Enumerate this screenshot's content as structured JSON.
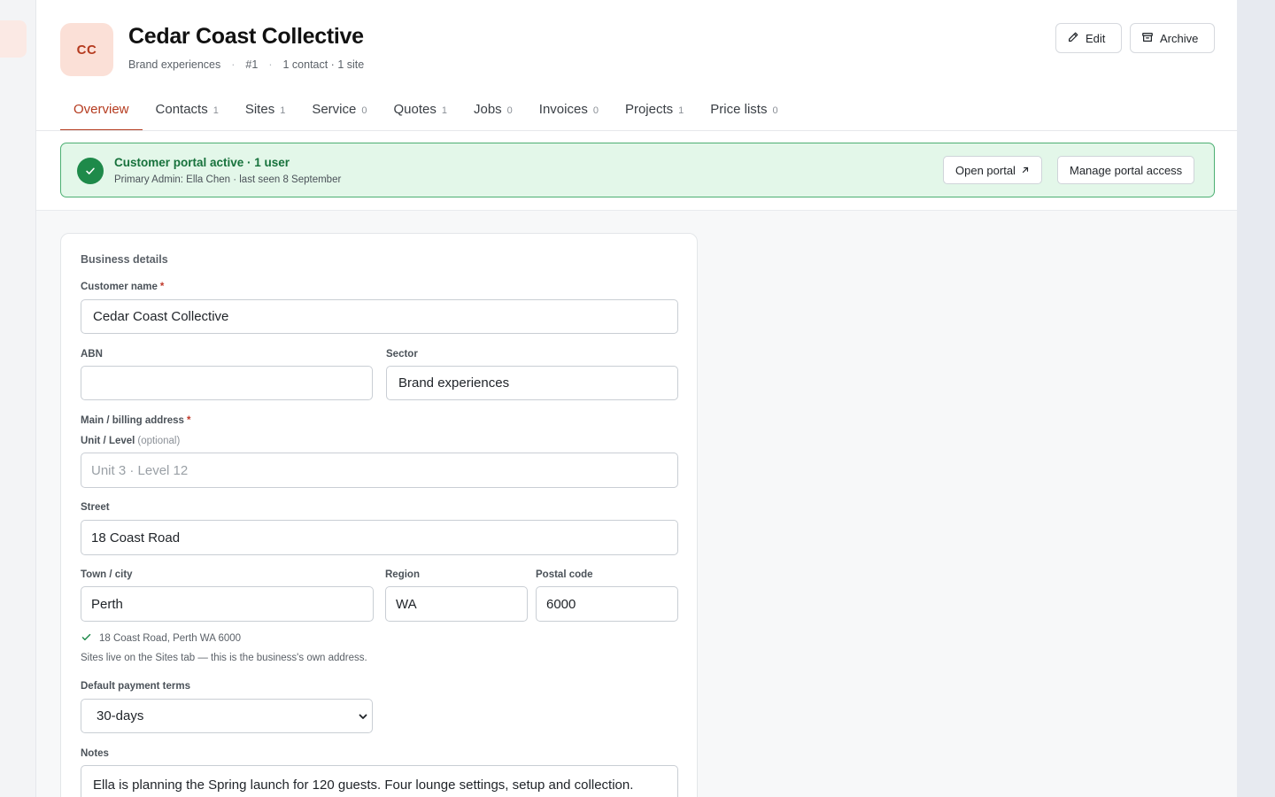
{
  "header": {
    "avatar_initials": "CC",
    "title": "Cedar Coast Collective",
    "meta_sector": "Brand experiences",
    "meta_number": "#1",
    "meta_counts": "1 contact · 1 site",
    "edit_label": "Edit",
    "archive_label": "Archive"
  },
  "tabs": [
    {
      "label": "Overview",
      "count": ""
    },
    {
      "label": "Contacts",
      "count": "1"
    },
    {
      "label": "Sites",
      "count": "1"
    },
    {
      "label": "Service",
      "count": "0"
    },
    {
      "label": "Quotes",
      "count": "1"
    },
    {
      "label": "Jobs",
      "count": "0"
    },
    {
      "label": "Invoices",
      "count": "0"
    },
    {
      "label": "Projects",
      "count": "1"
    },
    {
      "label": "Price lists",
      "count": "0"
    }
  ],
  "portal": {
    "title": "Customer portal active · 1 user",
    "subtitle": "Primary Admin: Ella Chen · last seen 8 September",
    "open_label": "Open portal",
    "manage_label": "Manage portal access"
  },
  "form": {
    "section_title": "Business details",
    "customer_name_label": "Customer name",
    "customer_name_value": "Cedar Coast Collective",
    "abn_label": "ABN",
    "abn_value": "",
    "sector_label": "Sector",
    "sector_value": "Brand experiences",
    "address_label": "Main / billing address",
    "unit_label": "Unit / Level",
    "unit_optional": "(optional)",
    "unit_placeholder": "Unit 3 · Level 12",
    "street_label": "Street",
    "street_value": "18 Coast Road",
    "town_label": "Town / city",
    "town_value": "Perth",
    "region_label": "Region",
    "region_value": "WA",
    "postal_label": "Postal code",
    "postal_value": "6000",
    "address_verified": "18 Coast Road, Perth WA 6000",
    "sites_hint": "Sites live on the Sites tab — this is the business's own address.",
    "payment_terms_label": "Default payment terms",
    "payment_terms_value": "30-days",
    "notes_label": "Notes",
    "notes_value": "Ella is planning the Spring launch for 120 guests. Four lounge settings, setup and collection."
  }
}
